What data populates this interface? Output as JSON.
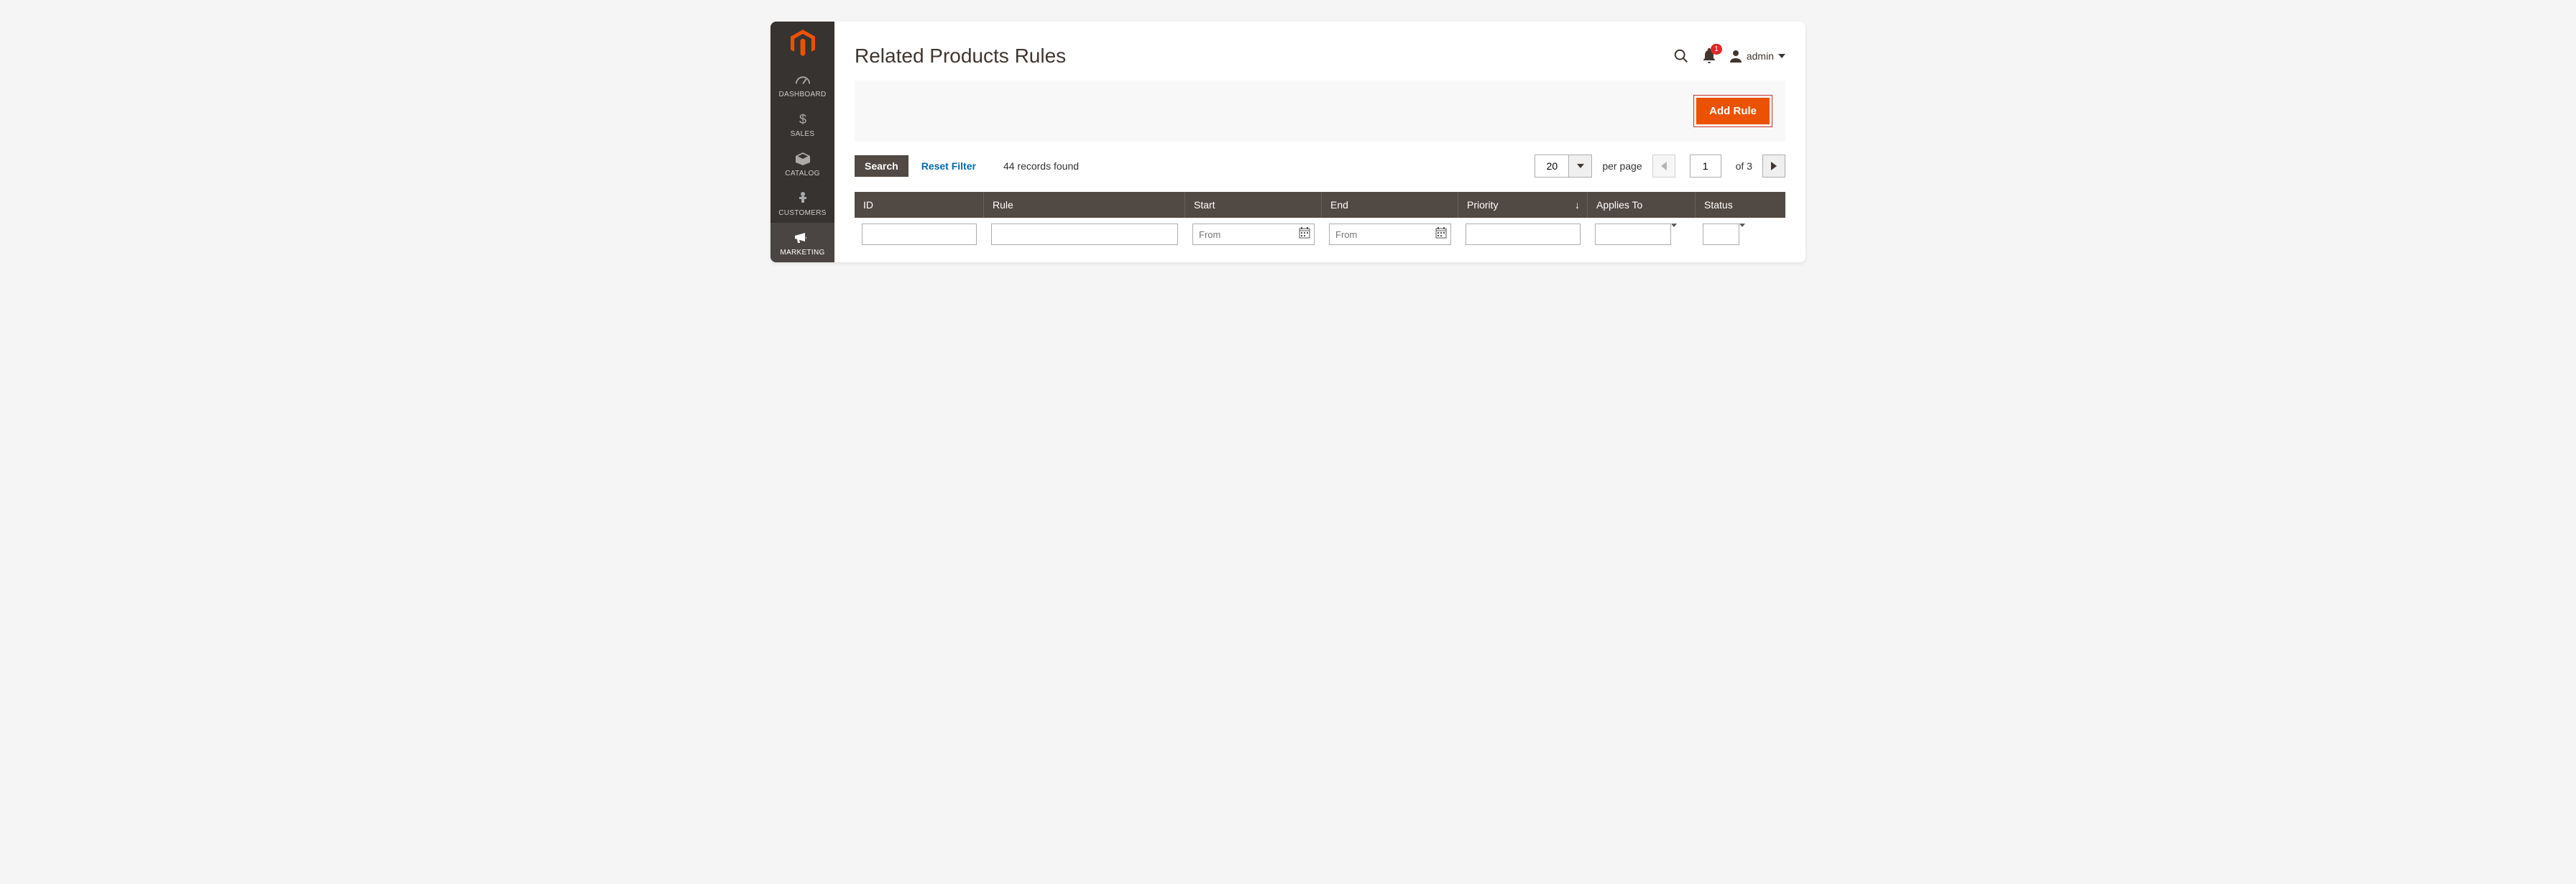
{
  "sidebar": {
    "items": [
      {
        "label": "DASHBOARD"
      },
      {
        "label": "SALES"
      },
      {
        "label": "CATALOG"
      },
      {
        "label": "CUSTOMERS"
      },
      {
        "label": "MARKETING"
      }
    ]
  },
  "header": {
    "title": "Related Products Rules",
    "user": "admin",
    "notifications": "1"
  },
  "actions": {
    "add_rule": "Add Rule"
  },
  "toolbar": {
    "search": "Search",
    "reset": "Reset Filter",
    "records_found": "44 records found",
    "page_size": "20",
    "per_page": "per page",
    "page": "1",
    "of": "of 3"
  },
  "grid": {
    "columns": {
      "id": "ID",
      "rule": "Rule",
      "start": "Start",
      "end": "End",
      "priority": "Priority",
      "applies": "Applies To",
      "status": "Status"
    },
    "filters": {
      "start_from": "From",
      "end_from": "From"
    }
  }
}
